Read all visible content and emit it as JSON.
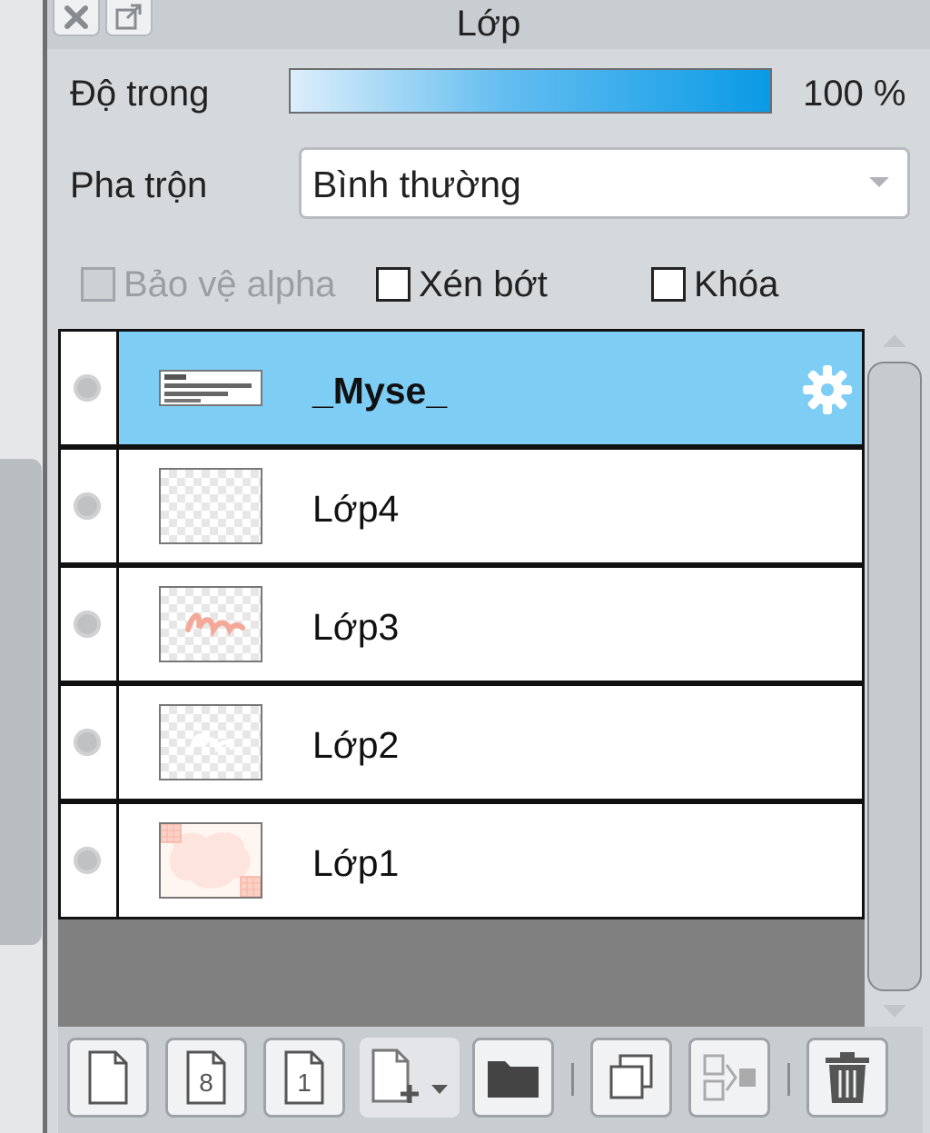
{
  "window": {
    "title": "Lớp",
    "close_icon": "close-icon",
    "detach_icon": "external-window-icon"
  },
  "opacity": {
    "label": "Độ trong",
    "value_text": "100 %",
    "value_fraction": 1.0
  },
  "blend": {
    "label": "Pha trộn",
    "value": "Bình thường"
  },
  "options": {
    "protect_alpha": {
      "label": "Bảo vệ alpha",
      "checked": false,
      "enabled": false
    },
    "clipping": {
      "label": "Xén bớt",
      "checked": false,
      "enabled": true
    },
    "lock": {
      "label": "Khóa",
      "checked": false,
      "enabled": true
    }
  },
  "layers": [
    {
      "name": "_Myse_",
      "selected": true,
      "thumb": "text"
    },
    {
      "name": "Lớp4",
      "selected": false,
      "thumb": "empty"
    },
    {
      "name": "Lớp3",
      "selected": false,
      "thumb": "pink-script"
    },
    {
      "name": "Lớp2",
      "selected": false,
      "thumb": "white-script"
    },
    {
      "name": "Lớp1",
      "selected": false,
      "thumb": "peach-shapes"
    }
  ],
  "toolbar": {
    "buttons": [
      {
        "name": "new-layer-button",
        "icon": "page-icon"
      },
      {
        "name": "new-8bit-layer-button",
        "icon": "page-8-icon",
        "glyph": "8"
      },
      {
        "name": "new-1bit-layer-button",
        "icon": "page-1-icon",
        "glyph": "1"
      },
      {
        "name": "add-layer-menu-button",
        "icon": "page-plus-dropdown-icon"
      },
      {
        "name": "new-folder-button",
        "icon": "folder-icon"
      },
      {
        "name": "duplicate-layer-button",
        "icon": "copy-icon"
      },
      {
        "name": "merge-down-button",
        "icon": "merge-icon"
      },
      {
        "name": "delete-layer-button",
        "icon": "trash-icon"
      }
    ]
  },
  "colors": {
    "selected_row": "#7ecdf5",
    "opacity_gradient_end": "#0a9ae6"
  }
}
